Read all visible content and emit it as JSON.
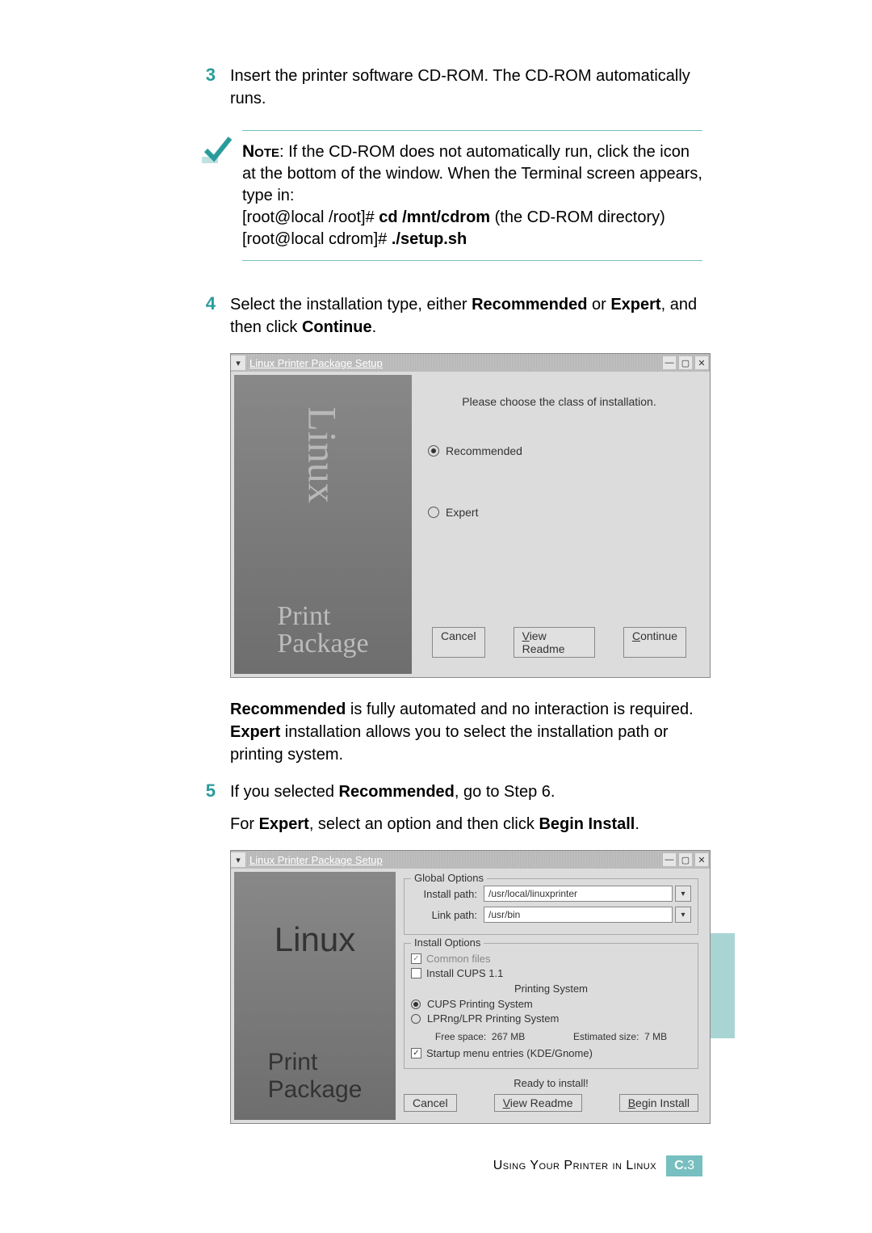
{
  "step3": {
    "num": "3",
    "text_a": "Insert the printer software CD-ROM. The CD-ROM automatically runs."
  },
  "note": {
    "label": "Note",
    "text1": ": If the CD-ROM does not automatically run, click the icon at the bottom of the window. When the Terminal screen appears, type in:",
    "line2_pre": "[root@local /root]# ",
    "line2_cmd": "cd /mnt/cdrom",
    "line2_post": " (the CD-ROM directory)",
    "line3_pre": "[root@local cdrom]# ",
    "line3_cmd": "./setup.sh"
  },
  "step4": {
    "num": "4",
    "text_a": "Select the installation type, either ",
    "b1": "Recommended",
    "text_b": " or ",
    "b2": "Expert",
    "text_c": ", and then click ",
    "b3": "Continue",
    "text_d": "."
  },
  "ss1": {
    "title": "Linux Printer Package Setup",
    "prompt": "Please choose the class of installation.",
    "opt1": "Recommended",
    "opt2": "Expert",
    "cancel": "Cancel",
    "view": "iew Readme",
    "view_u": "V",
    "cont": "ontinue",
    "cont_u": "C",
    "left1": "Linux",
    "left2a": "Print",
    "left2b": "Package"
  },
  "para1": {
    "b1": "Recommended",
    "t1": " is fully automated and no interaction is required. ",
    "b2": "Expert",
    "t2": " installation allows you to select the installation path or printing system."
  },
  "step5": {
    "num": "5",
    "t1": "If you selected ",
    "b1": "Recommended",
    "t2": ", go to Step 6."
  },
  "para2": {
    "t1": "For ",
    "b1": "Expert",
    "t2": ", select an option and then click ",
    "b2": "Begin Install",
    "t3": "."
  },
  "ss2": {
    "title": "Linux Printer Package Setup",
    "global": "Global Options",
    "install_path_l": "Install path:",
    "install_path_v": "/usr/local/linuxprinter",
    "link_path_l": "Link path:",
    "link_path_v": "/usr/bin",
    "install_opts": "Install Options",
    "common": "Common files",
    "cups11": "Install CUPS 1.1",
    "psys": "Printing System",
    "cups": "CUPS Printing System",
    "lpr": "LPRng/LPR Printing System",
    "free_l": "Free space:",
    "free_v": "267 MB",
    "est_l": "Estimated size:",
    "est_v": "7 MB",
    "startup": "Startup menu entries (KDE/Gnome)",
    "ready": "Ready to install!",
    "cancel": "Cancel",
    "view_u": "V",
    "view": "iew Readme",
    "begin_u": "B",
    "begin": "egin Install"
  },
  "footer": {
    "text": "Using Your Printer in Linux",
    "badge_a": "C.",
    "badge_b": "3"
  }
}
